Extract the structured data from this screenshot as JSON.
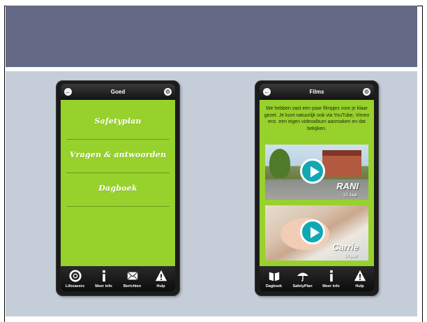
{
  "left_phone": {
    "title": "Goed",
    "menu": [
      "Safetyplan",
      "Vragen & antwoorden",
      "Dagboek"
    ],
    "tabs": [
      {
        "label": "Lifesavers",
        "icon": "lifebuoy-icon"
      },
      {
        "label": "Meer info",
        "icon": "info-icon"
      },
      {
        "label": "Berichten",
        "icon": "envelope-icon"
      },
      {
        "label": "Hulp",
        "icon": "warning-icon"
      }
    ]
  },
  "right_phone": {
    "title": "Films",
    "intro": "We hebben vast een paar filmpjes voor je klaar gezet. Je kunt natuurlijk ook via YouTube, Vimeo enz. een eigen videoalbum aanmaken en dat bekijken.",
    "videos": [
      {
        "name": "RANI",
        "age": "15 Jaar"
      },
      {
        "name": "Carrie",
        "age": "16 jaar"
      }
    ],
    "tabs": [
      {
        "label": "Dagboek",
        "icon": "book-icon"
      },
      {
        "label": "SafetyPlan",
        "icon": "umbrella-icon"
      },
      {
        "label": "Meer info",
        "icon": "info-icon"
      },
      {
        "label": "Hulp",
        "icon": "warning-icon"
      }
    ]
  },
  "colors": {
    "header_band": "#646985",
    "content_bg": "#c5ced8",
    "screen_green": "#97d12c",
    "play_button": "#11a8b4"
  }
}
